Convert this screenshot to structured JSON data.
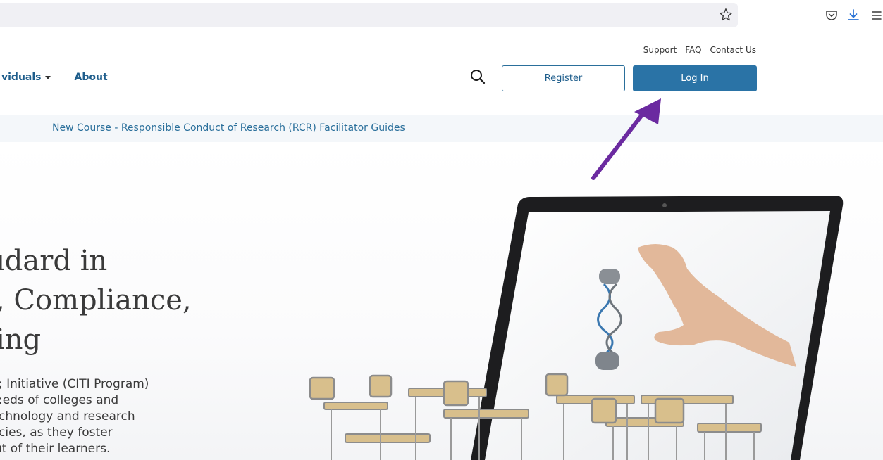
{
  "browser": {
    "icons": [
      "bookmark-star-icon",
      "pocket-icon",
      "download-icon",
      "menu-icon"
    ]
  },
  "header": {
    "util_links": [
      "Support",
      "FAQ",
      "Contact Us"
    ],
    "nav": {
      "individuals_label": "viduals",
      "about_label": "About"
    },
    "register_label": "Register",
    "login_label": "Log In"
  },
  "announcement": {
    "text": "New Course - Responsible Conduct of Research (RCR) Facilitator Guides"
  },
  "hero": {
    "title_lines": [
      "ıdard in",
      ", Compliance,",
      "ing"
    ],
    "desc_lines": [
      "; Initiative (CITI Program)",
      ":eds of colleges and",
      "chnology and research",
      "cies, as they foster",
      "ıt of their learners."
    ]
  },
  "colors": {
    "brand_blue": "#2a73a6",
    "link_blue": "#1f5e8c",
    "annotation_purple": "#6b2aa0"
  }
}
